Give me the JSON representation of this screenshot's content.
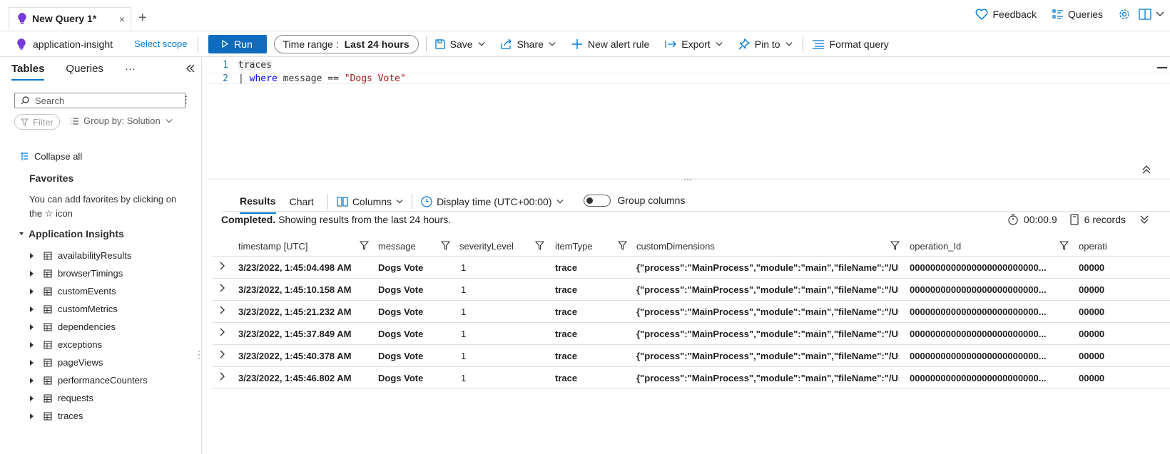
{
  "tab": {
    "title": "New Query 1*",
    "close": "×",
    "new": "+"
  },
  "topbar": {
    "feedback": "Feedback",
    "queries": "Queries"
  },
  "toolbar": {
    "scope_name": "application-insight",
    "select_scope": "Select scope",
    "run": "Run",
    "time_range_label": "Time range :",
    "time_range_value": "Last 24 hours",
    "save": "Save",
    "share": "Share",
    "new_alert": "New alert rule",
    "export": "Export",
    "pin": "Pin to",
    "format": "Format query"
  },
  "left": {
    "tabs": [
      "Tables",
      "Queries"
    ],
    "more": "···",
    "search_placeholder": "Search",
    "filter": "Filter",
    "group_by": "Group by: Solution",
    "collapse_all": "Collapse all",
    "favorites_title": "Favorites",
    "favorites_text": "You can add favorites by clicking on the ☆ icon",
    "section_title": "Application Insights",
    "tables": [
      "availabilityResults",
      "browserTimings",
      "customEvents",
      "customMetrics",
      "dependencies",
      "exceptions",
      "pageViews",
      "performanceCounters",
      "requests",
      "traces"
    ]
  },
  "editor": {
    "lines": [
      {
        "num": "1",
        "text": "traces"
      },
      {
        "num": "2",
        "pipe": "| ",
        "kw": "where",
        "mid": " message == ",
        "str": "\"Dogs Vote\""
      }
    ]
  },
  "results": {
    "tab_results": "Results",
    "tab_chart": "Chart",
    "columns": "Columns",
    "display_time": "Display time (UTC+00:00)",
    "group_columns": "Group columns",
    "status_bold": "Completed.",
    "status_text": " Showing results from the last 24 hours.",
    "duration": "00:00.9",
    "records": "6 records",
    "headers": [
      "timestamp [UTC]",
      "message",
      "severityLevel",
      "itemType",
      "customDimensions",
      "operation_Id",
      "operati"
    ],
    "rows": [
      [
        "3/23/2022, 1:45:04.498 AM",
        "Dogs Vote",
        "1",
        "trace",
        "{\"process\":\"MainProcess\",\"module\":\"main\",\"fileName\":\"/Us...",
        "0000000000000000000000000...",
        "00000"
      ],
      [
        "3/23/2022, 1:45:10.158 AM",
        "Dogs Vote",
        "1",
        "trace",
        "{\"process\":\"MainProcess\",\"module\":\"main\",\"fileName\":\"/Us...",
        "0000000000000000000000000...",
        "00000"
      ],
      [
        "3/23/2022, 1:45:21.232 AM",
        "Dogs Vote",
        "1",
        "trace",
        "{\"process\":\"MainProcess\",\"module\":\"main\",\"fileName\":\"/Us...",
        "0000000000000000000000000...",
        "00000"
      ],
      [
        "3/23/2022, 1:45:37.849 AM",
        "Dogs Vote",
        "1",
        "trace",
        "{\"process\":\"MainProcess\",\"module\":\"main\",\"fileName\":\"/Us...",
        "0000000000000000000000000...",
        "00000"
      ],
      [
        "3/23/2022, 1:45:40.378 AM",
        "Dogs Vote",
        "1",
        "trace",
        "{\"process\":\"MainProcess\",\"module\":\"main\",\"fileName\":\"/Us...",
        "0000000000000000000000000...",
        "00000"
      ],
      [
        "3/23/2022, 1:45:46.802 AM",
        "Dogs Vote",
        "1",
        "trace",
        "{\"process\":\"MainProcess\",\"module\":\"main\",\"fileName\":\"/Us...",
        "0000000000000000000000000...",
        "00000"
      ]
    ]
  },
  "colors": {
    "accent": "#0078d4",
    "run_button": "#0f6cbd",
    "brand_icon": "#773adc"
  }
}
